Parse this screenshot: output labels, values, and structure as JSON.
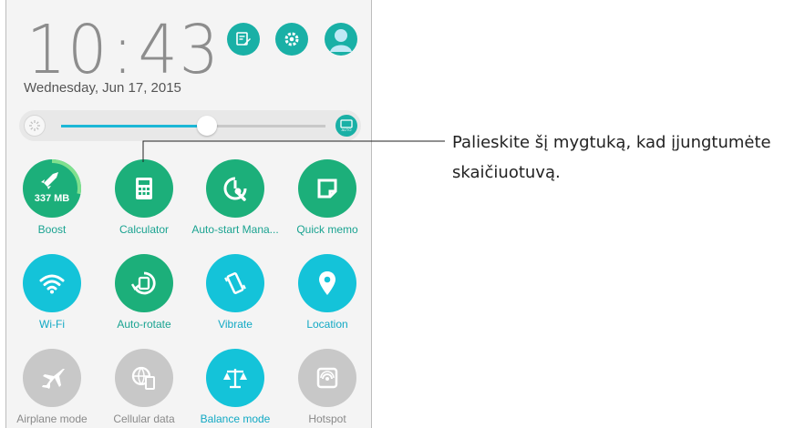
{
  "status": {
    "time_h": "10",
    "time_colon": ":",
    "time_m": "43",
    "date": "Wednesday, Jun 17, 2015"
  },
  "top_icons": [
    "edit-icon",
    "settings-icon",
    "profile-icon"
  ],
  "brightness": {
    "level": 0.55,
    "auto_label": "AUTO"
  },
  "boost": {
    "value": "337 MB",
    "ring_fraction": 0.28
  },
  "tiles": [
    {
      "label": "Boost",
      "icon": "rocket-icon",
      "color": "#1caf7a",
      "label_color": "#1aa391"
    },
    {
      "label": "Calculator",
      "icon": "calculator-icon",
      "color": "#1caf7a",
      "label_color": "#1aa391"
    },
    {
      "label": "Auto-start Mana...",
      "icon": "auto-start-icon",
      "color": "#1caf7a",
      "label_color": "#1aa391"
    },
    {
      "label": "Quick memo",
      "icon": "memo-icon",
      "color": "#1caf7a",
      "label_color": "#1aa391"
    },
    {
      "label": "Wi-Fi",
      "icon": "wifi-icon",
      "color": "#14c3d9",
      "label_color": "#12a9c4"
    },
    {
      "label": "Auto-rotate",
      "icon": "rotate-icon",
      "color": "#1caf7a",
      "label_color": "#1aa391"
    },
    {
      "label": "Vibrate",
      "icon": "vibrate-icon",
      "color": "#14c3d9",
      "label_color": "#12a9c4"
    },
    {
      "label": "Location",
      "icon": "location-icon",
      "color": "#14c3d9",
      "label_color": "#12a9c4"
    },
    {
      "label": "Airplane mode",
      "icon": "airplane-icon",
      "color": "#c8c8c8",
      "label_color": "#8a8a8a"
    },
    {
      "label": "Cellular data",
      "icon": "cellular-data-icon",
      "color": "#c8c8c8",
      "label_color": "#8a8a8a"
    },
    {
      "label": "Balance mode",
      "icon": "balance-icon",
      "color": "#14c3d9",
      "label_color": "#12a9c4"
    },
    {
      "label": "Hotspot",
      "icon": "hotspot-icon",
      "color": "#c8c8c8",
      "label_color": "#8a8a8a"
    }
  ],
  "callout": {
    "line1": "Palieskite šį mygtuką, kad įjungtumėte",
    "line2": "skaičiuotuvą."
  }
}
